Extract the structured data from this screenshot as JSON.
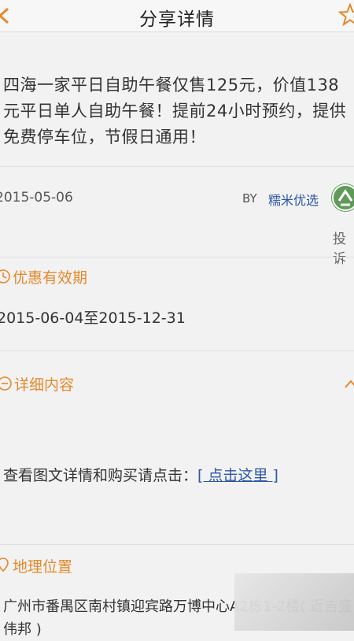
{
  "header": {
    "title": "分享详情"
  },
  "deal": {
    "title": "四海一家平日自助午餐仅售125元，价值138元平日单人自助午餐！提前24小时预约，提供免费停车位，节假日通用！",
    "date": "2015-05-06",
    "by_label": "BY",
    "author": "糯米优选",
    "report_label": "投诉"
  },
  "validity": {
    "heading": "优惠有效期",
    "range": "2015-06-04至2015-12-31"
  },
  "details": {
    "heading": "详细内容",
    "text": "查看图文详情和购买请点击：",
    "link": "[ 点击这里 ]"
  },
  "location": {
    "heading": "地理位置",
    "address": "广州市番禺区南村镇迎宾路万博中心A2栋1-2楼( 近吉盛伟邦 )"
  },
  "colors": {
    "accent": "#e6882a",
    "link": "#2c56a6",
    "avatar": "#5f9a5a"
  }
}
